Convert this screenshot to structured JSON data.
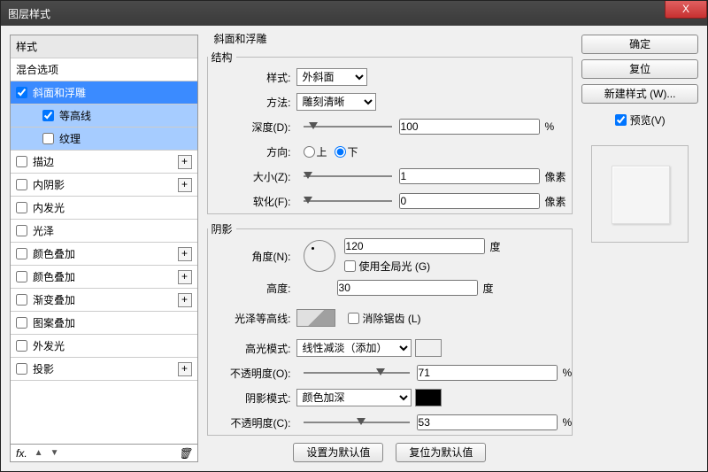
{
  "window": {
    "title": "图层样式"
  },
  "styles": {
    "header": "样式",
    "blend": "混合选项",
    "bevel": "斜面和浮雕",
    "contour": "等高线",
    "texture": "纹理",
    "stroke": "描边",
    "innerShadow": "内阴影",
    "innerGlow": "内发光",
    "satin": "光泽",
    "colorOverlay": "颜色叠加",
    "colorOverlay2": "颜色叠加",
    "gradientOverlay": "渐变叠加",
    "patternOverlay": "图案叠加",
    "outerGlow": "外发光",
    "dropShadow": "投影",
    "fx": "fx."
  },
  "bevelSection": {
    "title": "斜面和浮雕"
  },
  "structure": {
    "legend": "结构",
    "styleLabel": "样式:",
    "styleValue": "外斜面",
    "techLabel": "方法:",
    "techValue": "雕刻清晰",
    "depthLabel": "深度(D):",
    "depthValue": "100",
    "percent": "%",
    "dirLabel": "方向:",
    "up": "上",
    "down": "下",
    "sizeLabel": "大小(Z):",
    "sizeValue": "1",
    "px": "像素",
    "softenLabel": "软化(F):",
    "softenValue": "0"
  },
  "shading": {
    "legend": "阴影",
    "angleLabel": "角度(N):",
    "angleValue": "120",
    "deg": "度",
    "globalLight": "使用全局光 (G)",
    "altitudeLabel": "高度:",
    "altitudeValue": "30",
    "glossLabel": "光泽等高线:",
    "antialias": "消除锯齿 (L)",
    "hiliteModeLabel": "高光模式:",
    "hiliteModeValue": "线性减淡（添加）",
    "opacityLabel": "不透明度(O):",
    "hiliteOpacity": "71",
    "shadowModeLabel": "阴影模式:",
    "shadowModeValue": "颜色加深",
    "shadowOpacityLabel": "不透明度(C):",
    "shadowOpacity": "53"
  },
  "footer": {
    "default": "设置为默认值",
    "reset": "复位为默认值"
  },
  "right": {
    "ok": "确定",
    "cancel": "复位",
    "newStyle": "新建样式 (W)...",
    "preview": "预览(V)"
  },
  "colors": {
    "hilite": "#ffffff",
    "shadow": "#000000"
  }
}
